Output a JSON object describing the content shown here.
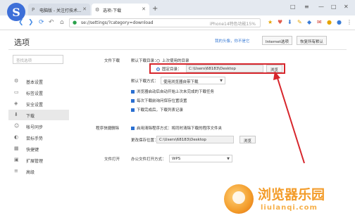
{
  "browser": {
    "tabs": [
      {
        "label": "电脑版 - 关注打技术...",
        "icon": "page-icon"
      },
      {
        "label": "选项-下载",
        "icon": "gear-icon"
      }
    ],
    "new_tab_symbol": "+",
    "window_controls": [
      "□",
      "—",
      "□",
      "✕"
    ]
  },
  "addressbar": {
    "url": "se://settings/?category=download",
    "suggestion": "iPhone14特色功能15%"
  },
  "header": {
    "title": "选项",
    "link": "我的头像，你不是它",
    "buttons": [
      "Internet选项",
      "恢复所有默认"
    ]
  },
  "sidebar": {
    "search_placeholder": "查找选项",
    "items": [
      {
        "label": "基本设置",
        "icon": "gear-icon"
      },
      {
        "label": "标签设置",
        "icon": "tab-icon"
      },
      {
        "label": "安全设置",
        "icon": "shield-icon"
      },
      {
        "label": "下载",
        "icon": "download-icon",
        "active": true
      },
      {
        "label": "帐号同步",
        "icon": "user-icon"
      },
      {
        "label": "鼠标手势",
        "icon": "mouse-icon"
      },
      {
        "label": "快捷键",
        "icon": "keyboard-icon"
      },
      {
        "label": "扩展管理",
        "icon": "extension-icon"
      },
      {
        "label": "高级",
        "icon": "advanced-icon"
      }
    ]
  },
  "download": {
    "section_label": "文件下载",
    "save_dir_label": "默认下载目录：",
    "radio_last": "上次使用的目录",
    "radio_fixed": "固定目录：",
    "fixed_path": "C:\\Users\\68183\\Desktop",
    "browse_label": "浏览",
    "method_label": "默认下载方式：",
    "method_value": "使用浏览器自带下载",
    "options": [
      "浏览器启动后自动开始上次未完成的下载任务",
      "每次下载前询问保存位置设置",
      "下载完成后，下载列表记录"
    ]
  },
  "cleanup": {
    "section_label": "程序快捷删除",
    "checkbox": "启用清除程序方式：将同时清除下载的程序文件夹",
    "dir_label": "更改保存位置：",
    "dir_path": "C:\\Users\\68183\\Desktop",
    "browse_label": "浏览"
  },
  "filetype": {
    "section_label": "文件打开",
    "label": "办公文件打开方式：",
    "value": "WPS"
  },
  "watermark": {
    "text": "浏览器乐园",
    "sub": "liulanqi.com"
  },
  "colors": {
    "accent": "#2a6fd1",
    "highlight": "#d7262c",
    "watermark": "#f39c2a"
  }
}
